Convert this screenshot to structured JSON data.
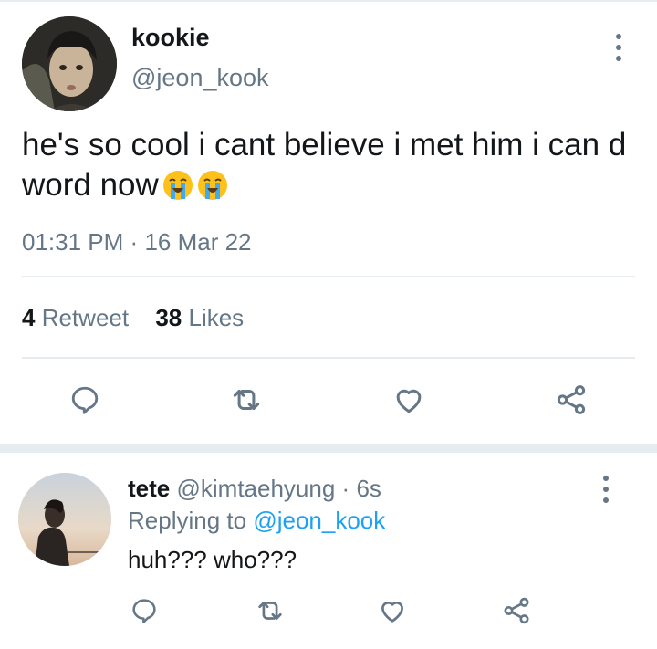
{
  "tweet": {
    "name": "kookie",
    "handle": "@jeon_kook",
    "text": "he's so cool i cant believe i met him i can d word now",
    "emojis": [
      "loudly-crying-face-icon",
      "loudly-crying-face-icon"
    ],
    "time": "01:31 PM",
    "dot": "·",
    "date": "16 Mar 22",
    "retweet_count": "4",
    "retweet_label": "Retweet",
    "likes_count": "38",
    "likes_label": "Likes"
  },
  "reply": {
    "name": "tete",
    "handle": "@kimtaehyung",
    "dot": "·",
    "time": "6s",
    "replying_label": "Replying to",
    "replying_to": "@jeon_kook",
    "text": "huh??? who???"
  },
  "colors": {
    "secondary_text": "#657786",
    "link": "#1da1f2",
    "divider": "#e6ecf0"
  },
  "icons": {
    "actions": [
      "reply-icon",
      "retweet-icon",
      "like-icon",
      "share-icon"
    ],
    "more": "more-vertical-icon"
  }
}
